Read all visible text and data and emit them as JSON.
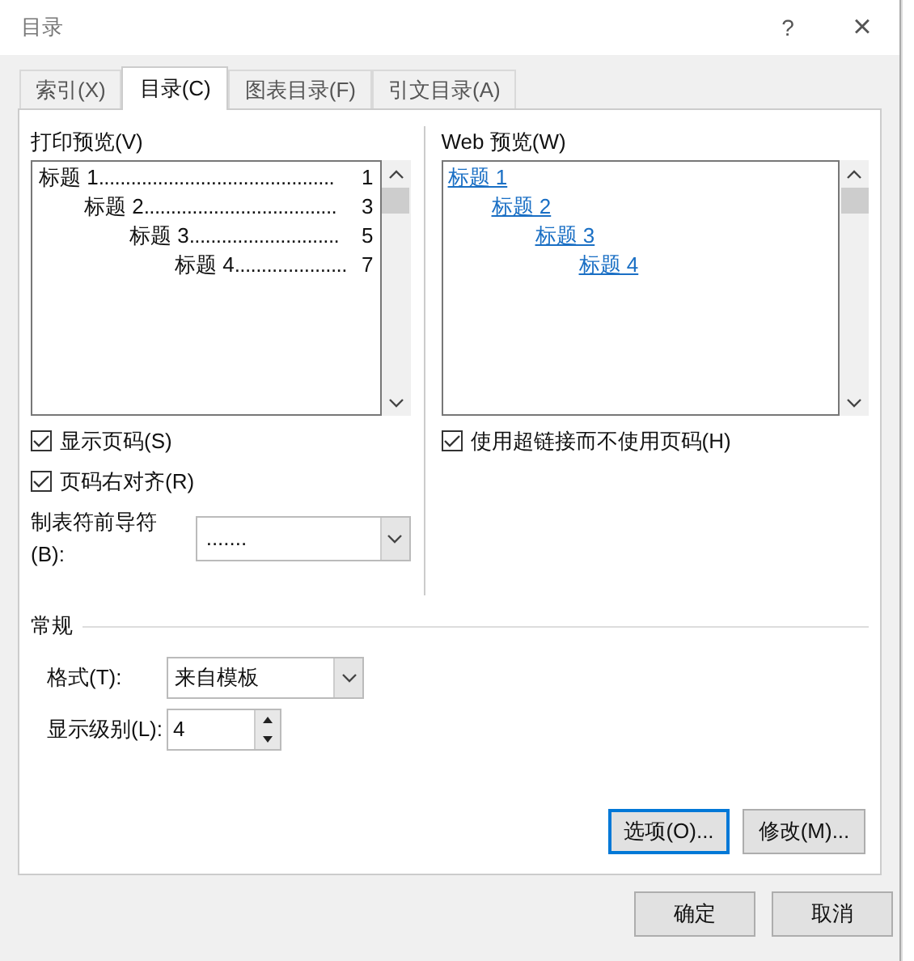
{
  "window": {
    "title": "目录",
    "help": "?",
    "close": "×"
  },
  "tabs": [
    {
      "label": "索引(X)",
      "selected": false
    },
    {
      "label": "目录(C)",
      "selected": true
    },
    {
      "label": "图表目录(F)",
      "selected": false
    },
    {
      "label": "引文目录(A)",
      "selected": false
    }
  ],
  "print_preview": {
    "label": "打印预览(V)",
    "entries": [
      {
        "text": "标题 1",
        "leader": "............................................",
        "page": "1",
        "children": [
          {
            "text": "标题 2",
            "leader": "....................................",
            "page": "3",
            "children": [
              {
                "text": "标题 3",
                "leader": "............................",
                "page": "5",
                "children": [
                  {
                    "text": "标题 4",
                    "leader": ".....................",
                    "page": "7"
                  }
                ]
              }
            ]
          }
        ]
      }
    ]
  },
  "web_preview": {
    "label": "Web 预览(W)",
    "entries": [
      {
        "text": "标题 1",
        "children": [
          {
            "text": "标题 2",
            "children": [
              {
                "text": "标题 3",
                "children": [
                  {
                    "text": "标题 4"
                  }
                ]
              }
            ]
          }
        ]
      }
    ]
  },
  "options_left": [
    {
      "label": "显示页码(S)",
      "checked": true
    },
    {
      "label": "页码右对齐(R)",
      "checked": true
    }
  ],
  "options_right": [
    {
      "label": "使用超链接而不使用页码(H)",
      "checked": true
    }
  ],
  "tab_leader": {
    "label": "制表符前导符(B):",
    "value": "......."
  },
  "general": {
    "title": "常规",
    "format": {
      "label": "格式(T):",
      "value": "来自模板"
    },
    "levels": {
      "label": "显示级别(L):",
      "value": "4"
    }
  },
  "panel_buttons": [
    {
      "label": "选项(O)...",
      "focused": true
    },
    {
      "label": "修改(M)...",
      "focused": false
    }
  ],
  "dialog_buttons": [
    "确定",
    "取消"
  ]
}
